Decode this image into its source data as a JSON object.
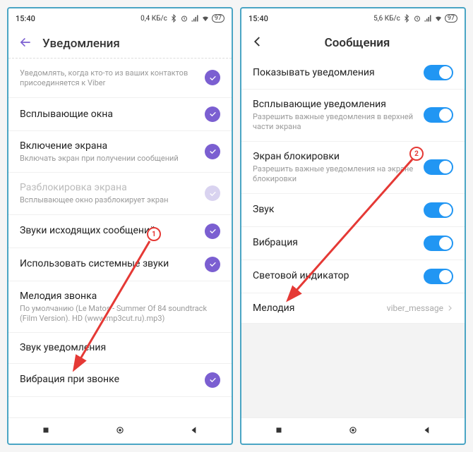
{
  "left": {
    "status": {
      "time": "15:40",
      "speed": "0,4 КБ/с",
      "battery": "97"
    },
    "header": {
      "title": "Уведомления"
    },
    "rows": {
      "r0_sub": "Уведомлять, когда кто-то из ваших контактов присоединяется к Viber",
      "r1": "Всплывающие окна",
      "r2": "Включение экрана",
      "r2_sub": "Включать экран при получении сообщений",
      "r3": "Разблокировка экрана",
      "r3_sub": "Всплывающее окно разблокирует экран",
      "r4": "Звуки исходящих сообщений",
      "r5": "Использовать системные звуки",
      "r6": "Мелодия звонка",
      "r6_sub": "По умолчанию (Le Matos - Summer Of 84 soundtrack (Film Version). HD (www.mp3cut.ru).mp3)",
      "r7": "Звук уведомления",
      "r8": "Вибрация при звонке"
    },
    "badge": "1"
  },
  "right": {
    "status": {
      "time": "15:40",
      "speed": "5,6 КБ/с",
      "battery": "97"
    },
    "header": {
      "title": "Сообщения"
    },
    "rows": {
      "r1": "Показывать уведомления",
      "r2": "Всплывающие уведомления",
      "r2_sub": "Разрешить важные уведомления в верхней части экрана",
      "r3": "Экран блокировки",
      "r3_sub": "Разрешить важные уведомления на экране блокировки",
      "r4": "Звук",
      "r5": "Вибрация",
      "r6": "Световой индикатор",
      "r7": "Мелодия",
      "r7_val": "viber_message"
    },
    "badge": "2"
  }
}
